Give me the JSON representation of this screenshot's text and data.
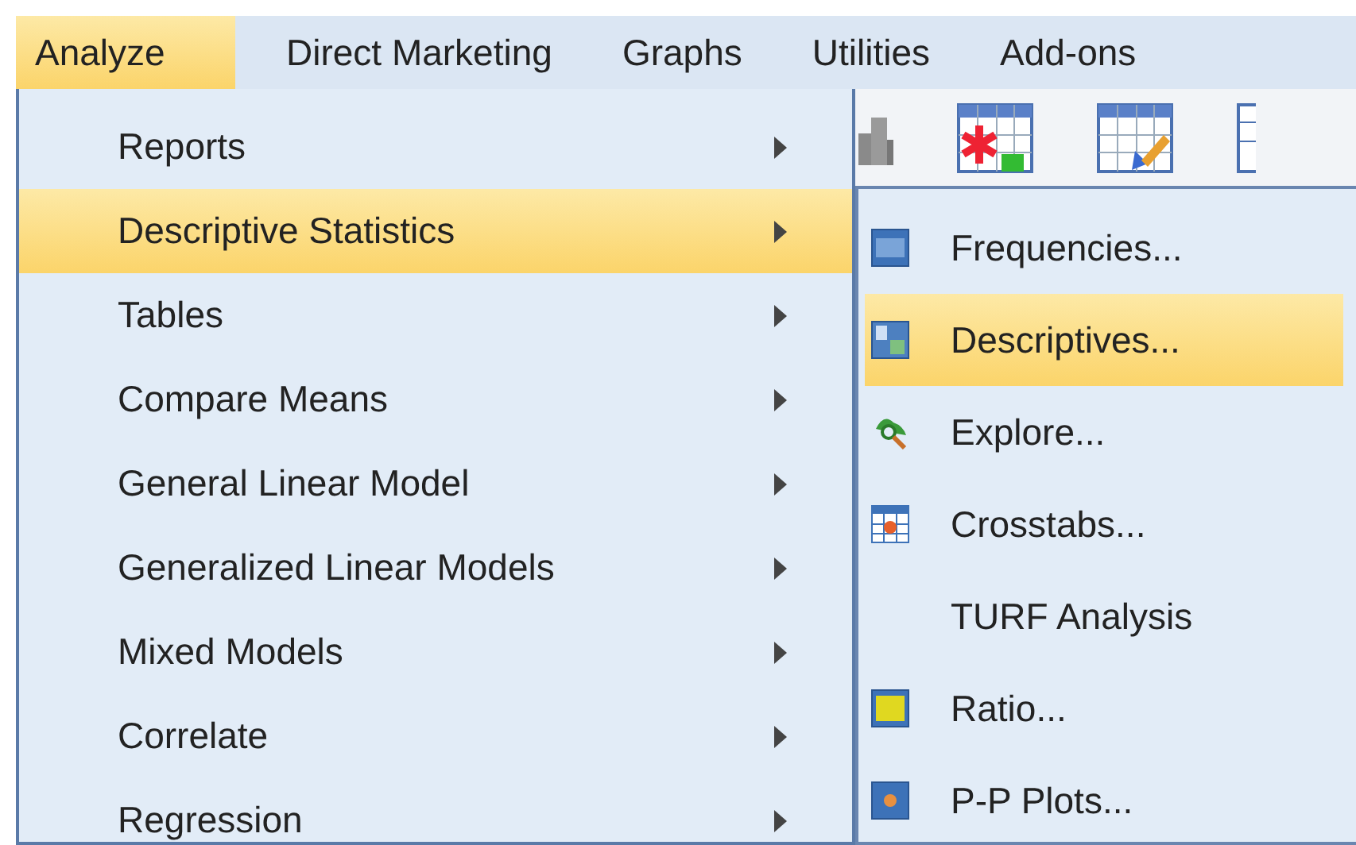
{
  "menu_bar": [
    {
      "label": "Analyze",
      "selected": true
    },
    {
      "label": "Direct Marketing",
      "selected": false
    },
    {
      "label": "Graphs",
      "selected": false
    },
    {
      "label": "Utilities",
      "selected": false
    },
    {
      "label": "Add-ons",
      "selected": false
    }
  ],
  "analyze_menu": [
    {
      "label": "Reports",
      "selected": false
    },
    {
      "label": "Descriptive Statistics",
      "selected": true
    },
    {
      "label": "Tables",
      "selected": false
    },
    {
      "label": "Compare Means",
      "selected": false
    },
    {
      "label": "General Linear Model",
      "selected": false
    },
    {
      "label": "Generalized Linear Models",
      "selected": false
    },
    {
      "label": "Mixed Models",
      "selected": false
    },
    {
      "label": "Correlate",
      "selected": false
    },
    {
      "label": "Regression",
      "selected": false
    }
  ],
  "submenu": [
    {
      "label": "Frequencies...",
      "kind": "frequencies",
      "selected": false
    },
    {
      "label": "Descriptives...",
      "kind": "descriptives",
      "selected": true
    },
    {
      "label": "Explore...",
      "kind": "explore",
      "selected": false
    },
    {
      "label": "Crosstabs...",
      "kind": "crosstabs",
      "selected": false
    },
    {
      "label": "TURF Analysis",
      "kind": "none",
      "selected": false
    },
    {
      "label": "Ratio...",
      "kind": "ratio",
      "selected": false
    },
    {
      "label": "P-P Plots...",
      "kind": "plots",
      "selected": false
    }
  ]
}
